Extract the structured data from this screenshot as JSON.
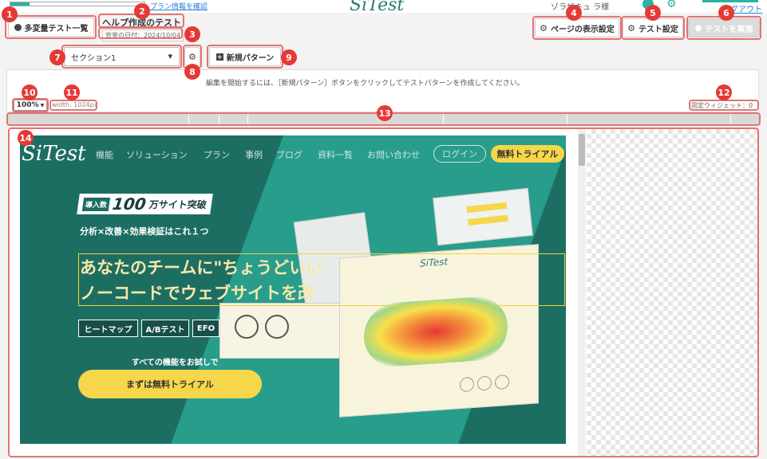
{
  "topbar": {
    "progress": 0.14,
    "plan_link": "プラン情報を確認",
    "logo": "SiTest",
    "user_name": "ゾラザキュ ラ様",
    "logout": "ログアウト"
  },
  "header": {
    "multivariate_list": "多変量テスト一覧",
    "title": "ヘルプ作成のテスト",
    "bg_date": "背景の日付：2024/10/04",
    "page_display_settings": "ページの表示設定",
    "test_settings": "テスト設定",
    "run_test": "テストを実施"
  },
  "toolbar": {
    "section_select": "セクション1",
    "new_pattern": "新規パターン"
  },
  "info": {
    "message": "編集を開始するには、［新規パターン］ボタンをクリックしてテストパターンを作成してください。",
    "zoom": "100%",
    "width": "width: 1024px",
    "fixed_widgets": "固定ウィジェット：0"
  },
  "badges": [
    "1",
    "2",
    "3",
    "4",
    "5",
    "6",
    "7",
    "8",
    "9",
    "10",
    "11",
    "12",
    "13",
    "14"
  ],
  "site": {
    "logo": "SiTest",
    "nav": [
      "機能",
      "ソリューション",
      "プラン",
      "事例",
      "ブログ",
      "資料一覧",
      "お問い合わせ"
    ],
    "login": "ログイン",
    "trial": "無料トライアル",
    "intro_tag": "導入数",
    "intro_num": "100",
    "intro_rest": "万サイト突破",
    "tagline": "分析×改善×効果検証はこれ１つ",
    "headline1": "あなたのチームに\"ちょうどいい",
    "headline2": "ノーコードでウェブサイトを改",
    "features": [
      "ヒートマップ",
      "A/Bテスト",
      "EFO"
    ],
    "all_features": "すべての機能をお試しで",
    "cta": "まずは無料トライアル",
    "mock_logo": "SiTest"
  },
  "colors": {
    "accent": "#2ab39f",
    "badge": "#e53935",
    "site_bg": "#1d6e62",
    "yellow": "#f6d64a"
  }
}
